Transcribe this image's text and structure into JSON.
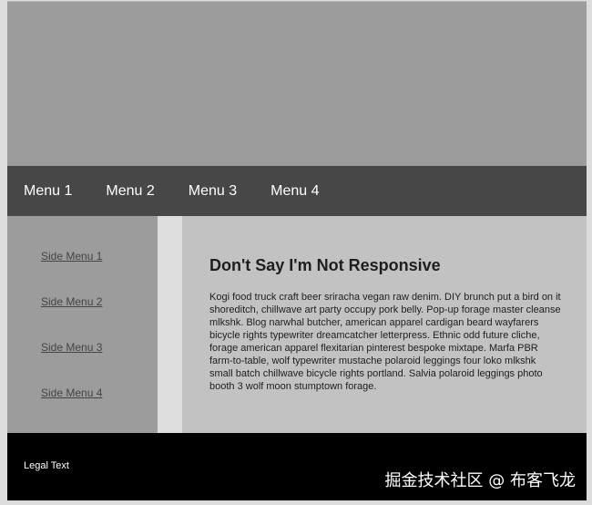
{
  "nav": {
    "items": [
      {
        "label": "Menu 1"
      },
      {
        "label": "Menu 2"
      },
      {
        "label": "Menu 3"
      },
      {
        "label": "Menu 4"
      }
    ]
  },
  "sidebar": {
    "items": [
      {
        "label": "Side Menu 1"
      },
      {
        "label": "Side Menu 2"
      },
      {
        "label": "Side Menu 3"
      },
      {
        "label": "Side Menu 4"
      }
    ]
  },
  "main": {
    "heading": "Don't Say I'm Not Responsive",
    "body": "Kogi food truck craft beer sriracha vegan raw denim. DIY brunch put a bird on it shoreditch, chillwave art party occupy pork belly. Pop-up forage master cleanse mlkshk. Blog narwhal butcher, american apparel cardigan beard wayfarers bicycle rights typewriter dreamcatcher letterpress. Ethnic odd future cliche, forage american apparel flexitarian pinterest bespoke mixtape. Marfa PBR farm-to-table, wolf typewriter mustache polaroid leggings four loko mlkshk small batch chillwave bicycle rights portland. Salvia polaroid leggings photo booth 3 wolf moon stumptown forage."
  },
  "footer": {
    "legal": "Legal Text",
    "watermark": "掘金技术社区 @ 布客飞龙"
  },
  "colors": {
    "header": "#9c9c9c",
    "nav": "#474747",
    "sidebar": "#9c9c9c",
    "gutter": "#dedede",
    "content": "#c2c2c2",
    "footer": "#000000"
  }
}
